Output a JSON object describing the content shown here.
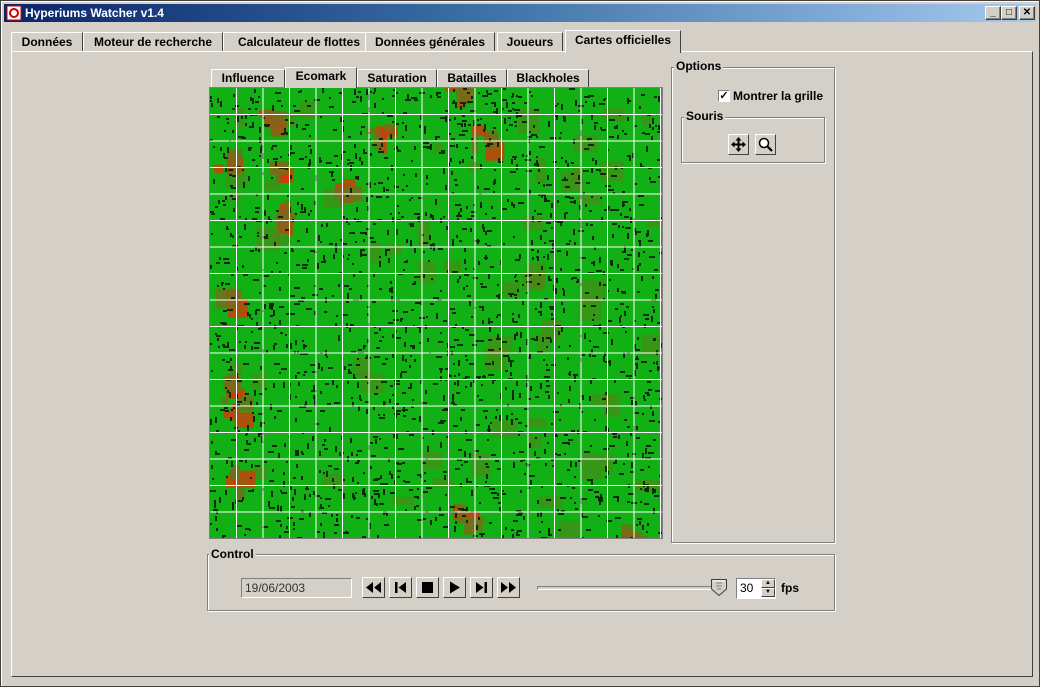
{
  "window": {
    "title": "Hyperiums Watcher v1.4",
    "controls": {
      "minimize": "_",
      "maximize": "□",
      "close": "✕"
    }
  },
  "main_tabs": [
    {
      "label": "Données",
      "active": false
    },
    {
      "label": "Moteur de recherche",
      "active": false
    },
    {
      "label": "Calculateur de flottes",
      "active": false
    },
    {
      "label": "Données générales",
      "active": false
    },
    {
      "label": "Joueurs",
      "active": false
    },
    {
      "label": "Cartes officielles",
      "active": true
    }
  ],
  "map_tabs": [
    {
      "label": "Influence",
      "active": false
    },
    {
      "label": "Ecomark",
      "active": true
    },
    {
      "label": "Saturation",
      "active": false
    },
    {
      "label": "Batailles",
      "active": false
    },
    {
      "label": "Blackholes",
      "active": false
    }
  ],
  "map": {
    "grid_visible": true,
    "colors": {
      "base": "#11b014",
      "grid": "#ffffff",
      "dark": "#0a2a08",
      "hot": "#e0300a",
      "warm": "#7a6a1a"
    }
  },
  "options": {
    "title": "Options",
    "show_grid_label": "Montrer la grille",
    "show_grid_checked": true,
    "mouse_group": {
      "title": "Souris",
      "tools": [
        {
          "icon": "move-icon",
          "label": "move"
        },
        {
          "icon": "magnifier-icon",
          "label": "zoom"
        }
      ]
    }
  },
  "control": {
    "title": "Control",
    "date": "19/06/2003",
    "buttons": [
      "rewind-icon",
      "step-back-icon",
      "stop-icon",
      "play-icon",
      "step-forward-icon",
      "fast-forward-icon"
    ],
    "speed_fraction": 1.0,
    "fps_value": "30",
    "fps_label": "fps"
  }
}
